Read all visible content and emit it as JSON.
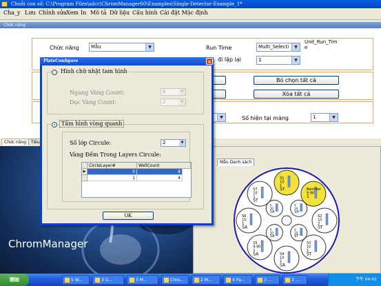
{
  "window": {
    "title": "Chuỗi con số: C:\\Program Files\\sdcc\\ChromManager60\\Examples\\Single-Detector-Example_1*"
  },
  "menu": [
    "Cha_y",
    "Lưu",
    "Chỉnh sửa",
    "Xem",
    "In",
    "Mô tả",
    "Dữ liệu",
    "Cấu hình",
    "Cài đặt Mặc định"
  ],
  "panel": {
    "header": "Chức năng",
    "func_label": "Chức năng",
    "func_value": "Mẫu",
    "run_time_label": "Run Time",
    "run_time_value": "Multi_Selecti",
    "unit_label": "Unit_Run_Time",
    "repeat_label": "đi lặp lại",
    "repeat_value": "1",
    "deselect_all": "Bỏ chọn tất cả",
    "delete_all": "Xóa tất cả",
    "current_layers_label": "Số hiện tại màng",
    "current_layers_value": "1"
  },
  "tabs": [
    "Chức năng",
    "Tiêu"
  ],
  "right_tab": "Mẫu Danh sách",
  "brand": "ChromManager",
  "dialog": {
    "title": "PlateConfigure",
    "rect_label": "Hình chữ nhật tam hình",
    "horiz_label": "Ngang Vàng Count:",
    "horiz_value": "6",
    "vert_label": "Dọc Vàng Count:",
    "vert_value": "2",
    "ring_label": "Tấm hình vòng quanh",
    "layers_label": "Số lớp Circule:",
    "layers_value": "2",
    "count_label": "Vàng Đếm Trong Layers Circule:",
    "grid_headers": [
      "CircleLayer#",
      "WellCount"
    ],
    "grid_rows": [
      [
        "0",
        "8"
      ],
      [
        "1",
        "4"
      ]
    ],
    "ok": "OK"
  },
  "plate": {
    "highlight": "#f3e23b",
    "wells": [
      {
        "label": "S1",
        "lines": [
          "10",
          "1",
          "ST"
        ]
      },
      {
        "label": "Reminer",
        "lines": [
          "9.90",
          "1"
        ]
      },
      {
        "label": "S2",
        "lines": [
          "10",
          "2",
          "ST"
        ]
      },
      {
        "label": "S3",
        "lines": [
          "10",
          "1",
          "ST"
        ]
      },
      {
        "label": "S4",
        "lines": [
          "10",
          "1",
          "SA"
        ]
      },
      {
        "label": "S5",
        "lines": [
          "9.90",
          "1",
          "SA"
        ]
      },
      {
        "label": "S6",
        "lines": [
          "10",
          "1",
          "SA"
        ]
      },
      {
        "label": "S7",
        "lines": [
          "10",
          "1",
          "ST"
        ]
      },
      {
        "label": "S",
        "lines": [
          "10",
          "SA"
        ]
      },
      {
        "label": "S",
        "lines": [
          "10",
          "SA"
        ]
      },
      {
        "label": "S",
        "lines": [
          "10",
          "ST"
        ]
      },
      {
        "label": "S",
        "lines": [
          "10",
          "SA"
        ]
      }
    ]
  },
  "taskbar": {
    "start": "開始",
    "items": [
      "5 W...",
      "3 G...",
      "3 M...",
      "Chro...",
      "2 M...",
      "4 Pa...",
      "3 ...",
      "3 ..."
    ],
    "clock": "下午 04:41"
  }
}
